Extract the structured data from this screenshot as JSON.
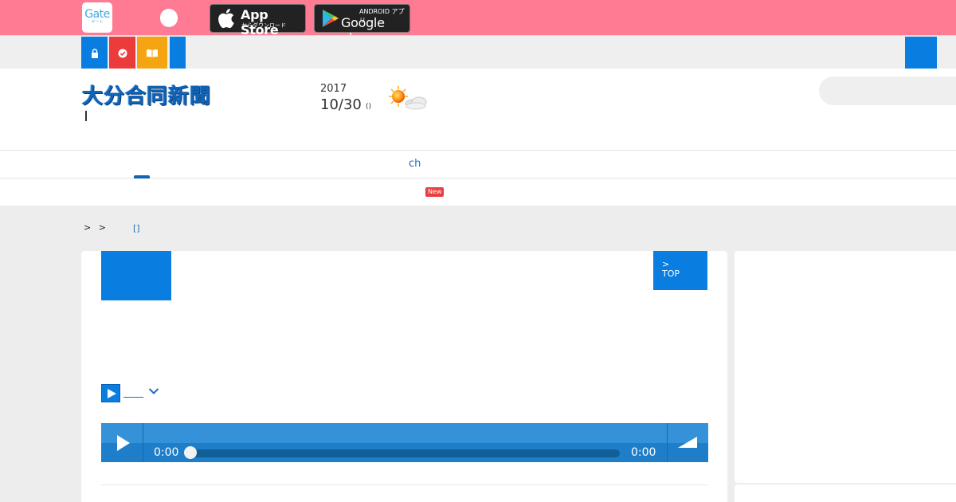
{
  "appbar": {
    "app_logo": "Gate",
    "app_logo_sub": "ゲート",
    "app_store": {
      "top": "",
      "main": "App Store",
      "sub": "からダウンロード"
    },
    "google_play": {
      "top": "ANDROID アプリ",
      "main": "Google play"
    },
    "background_color": "#ff7a93"
  },
  "utility_bar": {
    "buttons": [
      {
        "icon": "lock-icon",
        "color": "#0a7de0"
      },
      {
        "icon": "check-icon",
        "color": "#ec3b3b"
      },
      {
        "icon": "book-icon",
        "color": "#f6a512"
      },
      {
        "icon": "",
        "color": "#0a7de0"
      }
    ],
    "right_button_color": "#0a7de0"
  },
  "header": {
    "masthead": "大分合同新聞",
    "date_year": "2017",
    "date_main": "10/30",
    "date_dow": "()",
    "weather_icon": "sun-cloud-icon"
  },
  "nav": {
    "primary_item": "ch",
    "new_badge": "New"
  },
  "breadcrumb": {
    "separators": [
      ">",
      ">"
    ],
    "link": "[]"
  },
  "article": {
    "top_button_line1": ">",
    "top_button_line2": "TOP",
    "player": {
      "current_time": "0:00",
      "duration": "0:00",
      "progress": 0
    },
    "accent_color": "#0a7de0"
  }
}
